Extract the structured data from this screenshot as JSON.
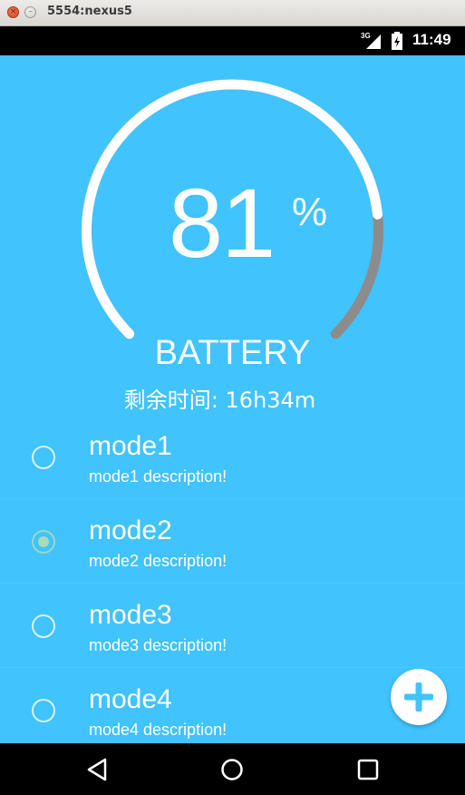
{
  "window": {
    "title": "5554:nexus5",
    "close_glyph": "×",
    "minimize_glyph": "–"
  },
  "statusbar": {
    "network": "3G",
    "time": "11:49",
    "icons": [
      "signal-icon",
      "battery-charging-icon"
    ]
  },
  "gauge": {
    "percent_value": "81",
    "percent_sign": "%",
    "level": 0.81,
    "label": "BATTERY",
    "remaining": "剩余时间: 16h34m",
    "filled_color": "#ffffff",
    "track_color": "#8c8c8c"
  },
  "modes": [
    {
      "title": "mode1",
      "description": "mode1 description!",
      "selected": false
    },
    {
      "title": "mode2",
      "description": "mode2 description!",
      "selected": true
    },
    {
      "title": "mode3",
      "description": "mode3 description!",
      "selected": false
    },
    {
      "title": "mode4",
      "description": "mode4 description!",
      "selected": false
    }
  ],
  "fab": {
    "icon": "plus-icon",
    "color": "#41c3fd"
  },
  "navbar": {
    "icons": [
      "back-icon",
      "home-icon",
      "recents-icon"
    ]
  },
  "colors": {
    "background": "#41c3fd",
    "accent": "#ffffff"
  }
}
